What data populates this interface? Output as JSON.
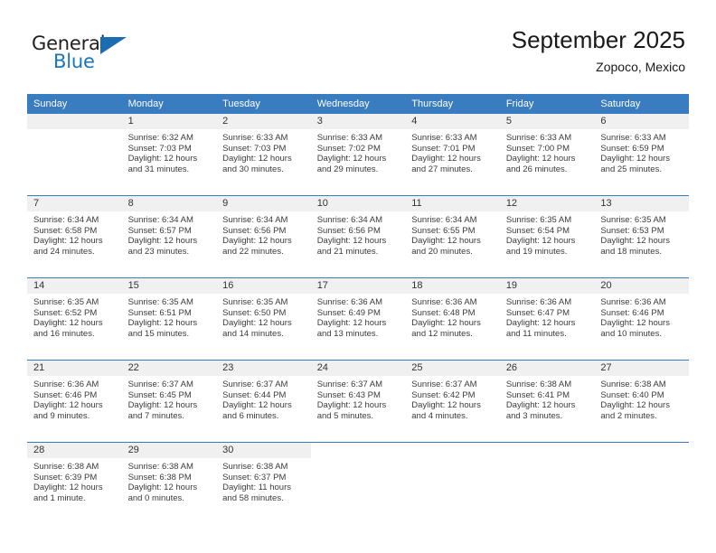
{
  "brand": {
    "name_part1": "General",
    "name_part2": "Blue",
    "triangle_color": "#1b6cb0"
  },
  "header": {
    "title": "September 2025",
    "subtitle": "Zopoco, Mexico"
  },
  "theme": {
    "header_blue": "#3a7cc0",
    "daynum_band": "#f0f0f0",
    "text": "#3b3b3b"
  },
  "weekdays": [
    "Sunday",
    "Monday",
    "Tuesday",
    "Wednesday",
    "Thursday",
    "Friday",
    "Saturday"
  ],
  "weeks": [
    [
      {
        "day": "",
        "sunrise": "",
        "sunset": "",
        "daylight": "",
        "empty": true
      },
      {
        "day": "1",
        "sunrise": "Sunrise: 6:32 AM",
        "sunset": "Sunset: 7:03 PM",
        "daylight": "Daylight: 12 hours and 31 minutes."
      },
      {
        "day": "2",
        "sunrise": "Sunrise: 6:33 AM",
        "sunset": "Sunset: 7:03 PM",
        "daylight": "Daylight: 12 hours and 30 minutes."
      },
      {
        "day": "3",
        "sunrise": "Sunrise: 6:33 AM",
        "sunset": "Sunset: 7:02 PM",
        "daylight": "Daylight: 12 hours and 29 minutes."
      },
      {
        "day": "4",
        "sunrise": "Sunrise: 6:33 AM",
        "sunset": "Sunset: 7:01 PM",
        "daylight": "Daylight: 12 hours and 27 minutes."
      },
      {
        "day": "5",
        "sunrise": "Sunrise: 6:33 AM",
        "sunset": "Sunset: 7:00 PM",
        "daylight": "Daylight: 12 hours and 26 minutes."
      },
      {
        "day": "6",
        "sunrise": "Sunrise: 6:33 AM",
        "sunset": "Sunset: 6:59 PM",
        "daylight": "Daylight: 12 hours and 25 minutes."
      }
    ],
    [
      {
        "day": "7",
        "sunrise": "Sunrise: 6:34 AM",
        "sunset": "Sunset: 6:58 PM",
        "daylight": "Daylight: 12 hours and 24 minutes."
      },
      {
        "day": "8",
        "sunrise": "Sunrise: 6:34 AM",
        "sunset": "Sunset: 6:57 PM",
        "daylight": "Daylight: 12 hours and 23 minutes."
      },
      {
        "day": "9",
        "sunrise": "Sunrise: 6:34 AM",
        "sunset": "Sunset: 6:56 PM",
        "daylight": "Daylight: 12 hours and 22 minutes."
      },
      {
        "day": "10",
        "sunrise": "Sunrise: 6:34 AM",
        "sunset": "Sunset: 6:56 PM",
        "daylight": "Daylight: 12 hours and 21 minutes."
      },
      {
        "day": "11",
        "sunrise": "Sunrise: 6:34 AM",
        "sunset": "Sunset: 6:55 PM",
        "daylight": "Daylight: 12 hours and 20 minutes."
      },
      {
        "day": "12",
        "sunrise": "Sunrise: 6:35 AM",
        "sunset": "Sunset: 6:54 PM",
        "daylight": "Daylight: 12 hours and 19 minutes."
      },
      {
        "day": "13",
        "sunrise": "Sunrise: 6:35 AM",
        "sunset": "Sunset: 6:53 PM",
        "daylight": "Daylight: 12 hours and 18 minutes."
      }
    ],
    [
      {
        "day": "14",
        "sunrise": "Sunrise: 6:35 AM",
        "sunset": "Sunset: 6:52 PM",
        "daylight": "Daylight: 12 hours and 16 minutes."
      },
      {
        "day": "15",
        "sunrise": "Sunrise: 6:35 AM",
        "sunset": "Sunset: 6:51 PM",
        "daylight": "Daylight: 12 hours and 15 minutes."
      },
      {
        "day": "16",
        "sunrise": "Sunrise: 6:35 AM",
        "sunset": "Sunset: 6:50 PM",
        "daylight": "Daylight: 12 hours and 14 minutes."
      },
      {
        "day": "17",
        "sunrise": "Sunrise: 6:36 AM",
        "sunset": "Sunset: 6:49 PM",
        "daylight": "Daylight: 12 hours and 13 minutes."
      },
      {
        "day": "18",
        "sunrise": "Sunrise: 6:36 AM",
        "sunset": "Sunset: 6:48 PM",
        "daylight": "Daylight: 12 hours and 12 minutes."
      },
      {
        "day": "19",
        "sunrise": "Sunrise: 6:36 AM",
        "sunset": "Sunset: 6:47 PM",
        "daylight": "Daylight: 12 hours and 11 minutes."
      },
      {
        "day": "20",
        "sunrise": "Sunrise: 6:36 AM",
        "sunset": "Sunset: 6:46 PM",
        "daylight": "Daylight: 12 hours and 10 minutes."
      }
    ],
    [
      {
        "day": "21",
        "sunrise": "Sunrise: 6:36 AM",
        "sunset": "Sunset: 6:46 PM",
        "daylight": "Daylight: 12 hours and 9 minutes."
      },
      {
        "day": "22",
        "sunrise": "Sunrise: 6:37 AM",
        "sunset": "Sunset: 6:45 PM",
        "daylight": "Daylight: 12 hours and 7 minutes."
      },
      {
        "day": "23",
        "sunrise": "Sunrise: 6:37 AM",
        "sunset": "Sunset: 6:44 PM",
        "daylight": "Daylight: 12 hours and 6 minutes."
      },
      {
        "day": "24",
        "sunrise": "Sunrise: 6:37 AM",
        "sunset": "Sunset: 6:43 PM",
        "daylight": "Daylight: 12 hours and 5 minutes."
      },
      {
        "day": "25",
        "sunrise": "Sunrise: 6:37 AM",
        "sunset": "Sunset: 6:42 PM",
        "daylight": "Daylight: 12 hours and 4 minutes."
      },
      {
        "day": "26",
        "sunrise": "Sunrise: 6:38 AM",
        "sunset": "Sunset: 6:41 PM",
        "daylight": "Daylight: 12 hours and 3 minutes."
      },
      {
        "day": "27",
        "sunrise": "Sunrise: 6:38 AM",
        "sunset": "Sunset: 6:40 PM",
        "daylight": "Daylight: 12 hours and 2 minutes."
      }
    ],
    [
      {
        "day": "28",
        "sunrise": "Sunrise: 6:38 AM",
        "sunset": "Sunset: 6:39 PM",
        "daylight": "Daylight: 12 hours and 1 minute."
      },
      {
        "day": "29",
        "sunrise": "Sunrise: 6:38 AM",
        "sunset": "Sunset: 6:38 PM",
        "daylight": "Daylight: 12 hours and 0 minutes."
      },
      {
        "day": "30",
        "sunrise": "Sunrise: 6:38 AM",
        "sunset": "Sunset: 6:37 PM",
        "daylight": "Daylight: 11 hours and 58 minutes."
      },
      {
        "day": "",
        "sunrise": "",
        "sunset": "",
        "daylight": "",
        "empty": true,
        "blank": true
      },
      {
        "day": "",
        "sunrise": "",
        "sunset": "",
        "daylight": "",
        "empty": true,
        "blank": true
      },
      {
        "day": "",
        "sunrise": "",
        "sunset": "",
        "daylight": "",
        "empty": true,
        "blank": true
      },
      {
        "day": "",
        "sunrise": "",
        "sunset": "",
        "daylight": "",
        "empty": true,
        "blank": true
      }
    ]
  ]
}
